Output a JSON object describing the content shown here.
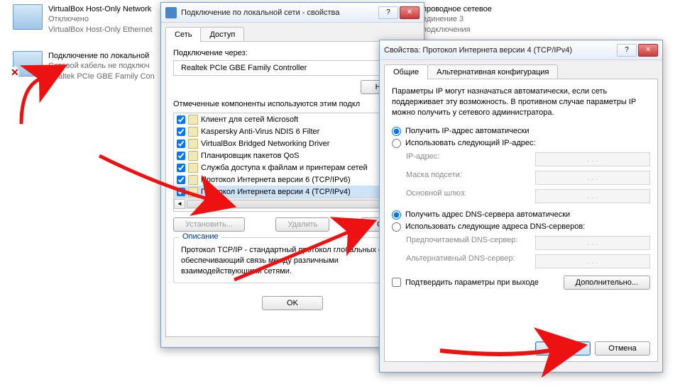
{
  "bg": {
    "conn1": {
      "title": "VirtualBox Host-Only Network",
      "status": "Отключено",
      "adapter": "VirtualBox Host-Only Ethernet"
    },
    "conn2_right": {
      "title": "проводное сетевое",
      "line2": "единение 3",
      "line3": "подключения"
    },
    "conn3": {
      "title": "Подключение по локальной",
      "status": "Сетевой кабель не подключ",
      "adapter": "Realtek PCIe GBE Family Con"
    }
  },
  "propWin": {
    "title": "Подключение по локальной сети - свойства",
    "tabs": {
      "network": "Сеть",
      "access": "Доступ"
    },
    "connectVia": "Подключение через:",
    "adapter": "Realtek PCIe GBE Family Controller",
    "configureBtn": "Настр",
    "componentsLabel": "Отмеченные компоненты используются этим подкл",
    "items": [
      "Клиент для сетей Microsoft",
      "Kaspersky Anti-Virus NDIS 6 Filter",
      "VirtualBox Bridged Networking Driver",
      "Планировщик пакетов QoS",
      "Служба доступа к файлам и принтерам сетей",
      "Протокол Интернета версии 6 (TCP/IPv6)",
      "Протокол Интернета версии 4 (TCP/IPv4)"
    ],
    "installBtn": "Установить...",
    "removeBtn": "Удалить",
    "propsBtn": "Свой",
    "descTitle": "Описание",
    "desc": "Протокол TCP/IP - стандартный протокол глобальных сетей, обеспечивающий связь между различными взаимодействующими сетями.",
    "ok": "OK"
  },
  "ipv4": {
    "title": "Свойства: Протокол Интернета версии 4 (TCP/IPv4)",
    "tabs": {
      "general": "Общие",
      "alt": "Альтернативная конфигурация"
    },
    "intro": "Параметры IP могут назначаться автоматически, если сеть поддерживает эту возможность. В противном случае параметры IP можно получить у сетевого администратора.",
    "ipAuto": "Получить IP-адрес автоматически",
    "ipManual": "Использовать следующий IP-адрес:",
    "ipAddr": "IP-адрес:",
    "mask": "Маска подсети:",
    "gateway": "Основной шлюз:",
    "dnsAuto": "Получить адрес DNS-сервера автоматически",
    "dnsManual": "Использовать следующие адреса DNS-серверов:",
    "dnsPref": "Предпочитаемый DNS-сервер:",
    "dnsAlt": "Альтернативный DNS-сервер:",
    "confirm": "Подтвердить параметры при выходе",
    "advanced": "Дополнительно...",
    "ok": "OK",
    "cancel": "Отмена",
    "dots": ".    .    ."
  }
}
